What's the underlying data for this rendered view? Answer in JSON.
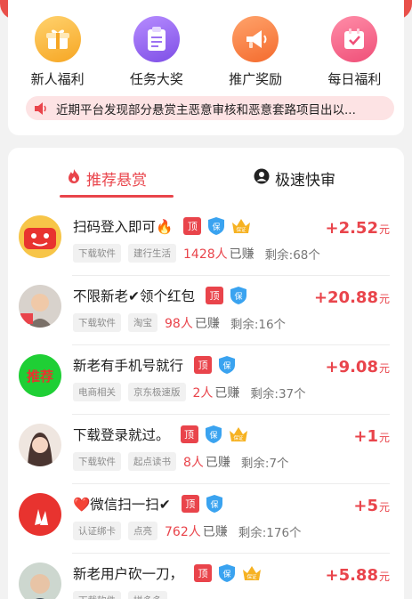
{
  "categories": [
    {
      "label": "新人福利",
      "icon": "gift-icon"
    },
    {
      "label": "任务大奖",
      "icon": "clipboard-icon"
    },
    {
      "label": "推广奖励",
      "icon": "megaphone-icon"
    },
    {
      "label": "每日福利",
      "icon": "calendar-check-icon"
    }
  ],
  "notice": {
    "text": "近期平台发现部分悬赏主恶意审核和恶意套路项目出以..."
  },
  "tabs": {
    "recommended": "推荐悬赏",
    "fast": "极速快审"
  },
  "badges": {
    "ding": "顶",
    "bao": "保",
    "crown": "保证"
  },
  "tasks": [
    {
      "title": "扫码登入即可🔥",
      "tags": [
        "下载软件",
        "建行生活"
      ],
      "count": "1428人",
      "done_label": "已赚",
      "remaining": "剩余:68个",
      "reward": "+2.52",
      "unit": "元",
      "badges": [
        "ding",
        "bao",
        "crown"
      ]
    },
    {
      "title": "不限新老✔领个红包",
      "tags": [
        "下载软件",
        "淘宝"
      ],
      "count": "98人",
      "done_label": "已赚",
      "remaining": "剩余:16个",
      "reward": "+20.88",
      "unit": "元",
      "badges": [
        "ding",
        "bao"
      ]
    },
    {
      "title": "新老有手机号就行",
      "tags": [
        "电商相关",
        "京东极速版"
      ],
      "count": "2人",
      "done_label": "已赚",
      "remaining": "剩余:37个",
      "reward": "+9.08",
      "unit": "元",
      "badges": [
        "ding",
        "bao"
      ],
      "avatar_text": "推荐"
    },
    {
      "title": "下载登录就过。",
      "tags": [
        "下载软件",
        "起点读书"
      ],
      "count": "8人",
      "done_label": "已赚",
      "remaining": "剩余:7个",
      "reward": "+1",
      "unit": "元",
      "badges": [
        "ding",
        "bao",
        "crown"
      ]
    },
    {
      "title": "❤️微信扫一扫✔",
      "tags": [
        "认证绑卡",
        "点亮"
      ],
      "count": "762人",
      "done_label": "已赚",
      "remaining": "剩余:176个",
      "reward": "+5",
      "unit": "元",
      "badges": [
        "ding",
        "bao"
      ]
    },
    {
      "title": "新老用户砍一刀，",
      "tags": [
        "下载软件",
        "拼多多"
      ],
      "count": "",
      "done_label": "",
      "remaining": "",
      "reward": "+5.88",
      "unit": "元",
      "badges": [
        "ding",
        "bao",
        "crown"
      ]
    }
  ],
  "colors": {
    "accent": "#e9444b",
    "top_band": "#e9504a",
    "notice_bg": "#fde3e4"
  }
}
